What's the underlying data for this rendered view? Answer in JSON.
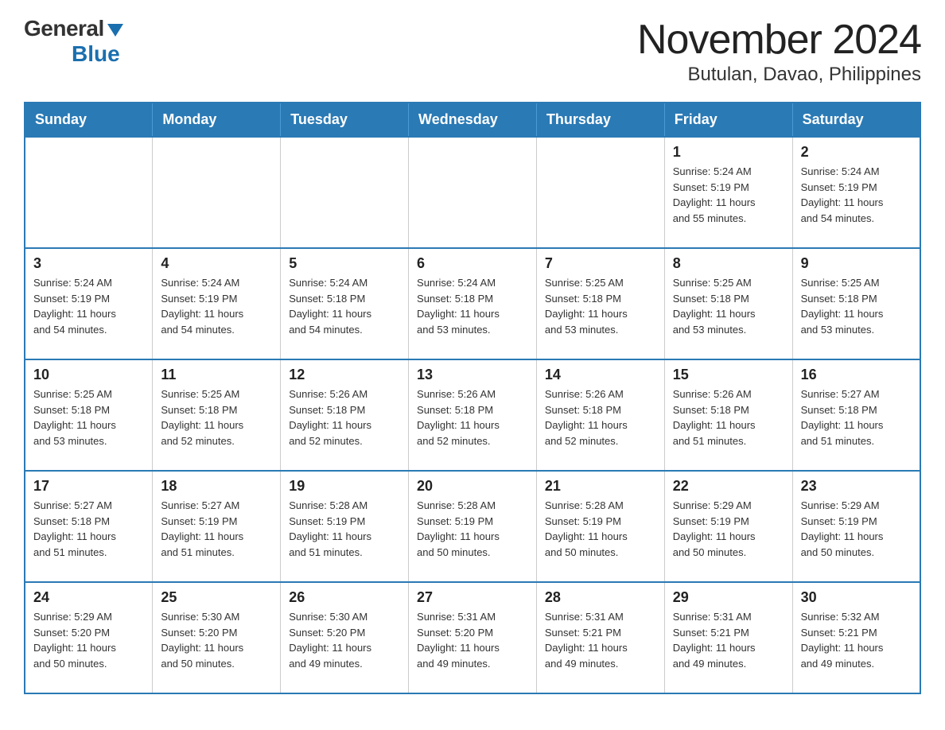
{
  "logo": {
    "general": "General",
    "blue": "Blue",
    "triangle": "▼"
  },
  "title": "November 2024",
  "subtitle": "Butulan, Davao, Philippines",
  "days_of_week": [
    "Sunday",
    "Monday",
    "Tuesday",
    "Wednesday",
    "Thursday",
    "Friday",
    "Saturday"
  ],
  "weeks": [
    [
      {
        "day": "",
        "info": ""
      },
      {
        "day": "",
        "info": ""
      },
      {
        "day": "",
        "info": ""
      },
      {
        "day": "",
        "info": ""
      },
      {
        "day": "",
        "info": ""
      },
      {
        "day": "1",
        "info": "Sunrise: 5:24 AM\nSunset: 5:19 PM\nDaylight: 11 hours\nand 55 minutes."
      },
      {
        "day": "2",
        "info": "Sunrise: 5:24 AM\nSunset: 5:19 PM\nDaylight: 11 hours\nand 54 minutes."
      }
    ],
    [
      {
        "day": "3",
        "info": "Sunrise: 5:24 AM\nSunset: 5:19 PM\nDaylight: 11 hours\nand 54 minutes."
      },
      {
        "day": "4",
        "info": "Sunrise: 5:24 AM\nSunset: 5:19 PM\nDaylight: 11 hours\nand 54 minutes."
      },
      {
        "day": "5",
        "info": "Sunrise: 5:24 AM\nSunset: 5:18 PM\nDaylight: 11 hours\nand 54 minutes."
      },
      {
        "day": "6",
        "info": "Sunrise: 5:24 AM\nSunset: 5:18 PM\nDaylight: 11 hours\nand 53 minutes."
      },
      {
        "day": "7",
        "info": "Sunrise: 5:25 AM\nSunset: 5:18 PM\nDaylight: 11 hours\nand 53 minutes."
      },
      {
        "day": "8",
        "info": "Sunrise: 5:25 AM\nSunset: 5:18 PM\nDaylight: 11 hours\nand 53 minutes."
      },
      {
        "day": "9",
        "info": "Sunrise: 5:25 AM\nSunset: 5:18 PM\nDaylight: 11 hours\nand 53 minutes."
      }
    ],
    [
      {
        "day": "10",
        "info": "Sunrise: 5:25 AM\nSunset: 5:18 PM\nDaylight: 11 hours\nand 53 minutes."
      },
      {
        "day": "11",
        "info": "Sunrise: 5:25 AM\nSunset: 5:18 PM\nDaylight: 11 hours\nand 52 minutes."
      },
      {
        "day": "12",
        "info": "Sunrise: 5:26 AM\nSunset: 5:18 PM\nDaylight: 11 hours\nand 52 minutes."
      },
      {
        "day": "13",
        "info": "Sunrise: 5:26 AM\nSunset: 5:18 PM\nDaylight: 11 hours\nand 52 minutes."
      },
      {
        "day": "14",
        "info": "Sunrise: 5:26 AM\nSunset: 5:18 PM\nDaylight: 11 hours\nand 52 minutes."
      },
      {
        "day": "15",
        "info": "Sunrise: 5:26 AM\nSunset: 5:18 PM\nDaylight: 11 hours\nand 51 minutes."
      },
      {
        "day": "16",
        "info": "Sunrise: 5:27 AM\nSunset: 5:18 PM\nDaylight: 11 hours\nand 51 minutes."
      }
    ],
    [
      {
        "day": "17",
        "info": "Sunrise: 5:27 AM\nSunset: 5:18 PM\nDaylight: 11 hours\nand 51 minutes."
      },
      {
        "day": "18",
        "info": "Sunrise: 5:27 AM\nSunset: 5:19 PM\nDaylight: 11 hours\nand 51 minutes."
      },
      {
        "day": "19",
        "info": "Sunrise: 5:28 AM\nSunset: 5:19 PM\nDaylight: 11 hours\nand 51 minutes."
      },
      {
        "day": "20",
        "info": "Sunrise: 5:28 AM\nSunset: 5:19 PM\nDaylight: 11 hours\nand 50 minutes."
      },
      {
        "day": "21",
        "info": "Sunrise: 5:28 AM\nSunset: 5:19 PM\nDaylight: 11 hours\nand 50 minutes."
      },
      {
        "day": "22",
        "info": "Sunrise: 5:29 AM\nSunset: 5:19 PM\nDaylight: 11 hours\nand 50 minutes."
      },
      {
        "day": "23",
        "info": "Sunrise: 5:29 AM\nSunset: 5:19 PM\nDaylight: 11 hours\nand 50 minutes."
      }
    ],
    [
      {
        "day": "24",
        "info": "Sunrise: 5:29 AM\nSunset: 5:20 PM\nDaylight: 11 hours\nand 50 minutes."
      },
      {
        "day": "25",
        "info": "Sunrise: 5:30 AM\nSunset: 5:20 PM\nDaylight: 11 hours\nand 50 minutes."
      },
      {
        "day": "26",
        "info": "Sunrise: 5:30 AM\nSunset: 5:20 PM\nDaylight: 11 hours\nand 49 minutes."
      },
      {
        "day": "27",
        "info": "Sunrise: 5:31 AM\nSunset: 5:20 PM\nDaylight: 11 hours\nand 49 minutes."
      },
      {
        "day": "28",
        "info": "Sunrise: 5:31 AM\nSunset: 5:21 PM\nDaylight: 11 hours\nand 49 minutes."
      },
      {
        "day": "29",
        "info": "Sunrise: 5:31 AM\nSunset: 5:21 PM\nDaylight: 11 hours\nand 49 minutes."
      },
      {
        "day": "30",
        "info": "Sunrise: 5:32 AM\nSunset: 5:21 PM\nDaylight: 11 hours\nand 49 minutes."
      }
    ]
  ]
}
